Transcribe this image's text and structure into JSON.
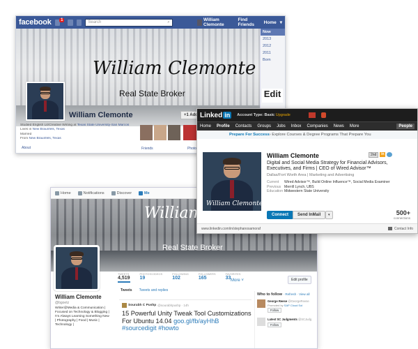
{
  "facebook": {
    "logo": "facebook",
    "notification_count": "1",
    "search_placeholder": "Search",
    "user_name": "William Clemonte",
    "nav": [
      "Find Friends",
      "Home"
    ],
    "cover_script": "William Clemonte",
    "cover_subtitle": "Real State Broker",
    "years": [
      "Now",
      "2013",
      "2012",
      "2011",
      "Born"
    ],
    "edit_text": "Edit",
    "profile_name": "William Clemonte",
    "add_friend": "+1 Add Friend",
    "info": [
      {
        "pre": "Studied English Lit/Creative Writing at ",
        "link": "Texas State University-San Marcos"
      },
      {
        "pre": "Lives in ",
        "link": "New Braunfels, Texas"
      },
      {
        "pre": "Married",
        "link": ""
      },
      {
        "pre": "From ",
        "link": "New Braunfels, Texas"
      }
    ],
    "about": "About",
    "friends": "Friends",
    "photos": "Photos"
  },
  "linkedin": {
    "logo_text": "Linked",
    "logo_in": "in",
    "account": "Account Type: Basic",
    "upgrade": "Upgrade",
    "nav": [
      "Home",
      "Profile",
      "Contacts",
      "Groups",
      "Jobs",
      "Inbox",
      "Companies",
      "News",
      "More"
    ],
    "people": "People",
    "banner_bold": "Prepare For Success",
    "banner_rest": " › Explore Courses & Degree Programs That Prepare You",
    "name": "William Clemonte",
    "degree": "2nd",
    "headline": "Digital and Social Media Strategy for Financial Advisors, Executives, and Firms | CEO of Wired Advisor™",
    "location": "Dallas/Fort Worth Area  |  Marketing and Advertising",
    "rows": [
      {
        "k": "Current",
        "v": "Wired Advisor™, Build Online Influence™, Social Media Examiner"
      },
      {
        "k": "Previous",
        "v": "Merrill Lynch, UBS"
      },
      {
        "k": "Education",
        "v": "Midwestern State University"
      }
    ],
    "connect": "Connect",
    "send_inmail": "Send InMail",
    "connections_num": "500+",
    "connections_lbl": "connections",
    "url": "www.linkedin.com/in/stephanosamoraf",
    "contact_info": "Contact Info",
    "photo_signature": "William Clemonte"
  },
  "twitter": {
    "nav": [
      "Home",
      "Notifications",
      "Discover",
      "Me"
    ],
    "cover_script": "William Cl",
    "cover_subtitle": "Real State Broker",
    "stats": [
      {
        "l": "Tweets",
        "v": "4,519"
      },
      {
        "l": "Photos/Videos",
        "v": "19"
      },
      {
        "l": "Following",
        "v": "102"
      },
      {
        "l": "Followers",
        "v": "165"
      },
      {
        "l": "Favorites",
        "v": "33"
      }
    ],
    "more": "More ˅",
    "edit_profile": "Edit profile",
    "name": "William Clemonte",
    "handle": "@bgoetz",
    "bio": "Writer@Media & Communication | Focused on Technology & Blogging | I'm Always Learning Something New | Photography | Food | Music | Technology |",
    "tabs": [
      "Tweets",
      "Tweets and replies"
    ],
    "tweet_author": "Sourabh C Pushp",
    "tweet_handle": "@sourabhpushp · 14h",
    "tweet_text": "15 Powerful Unity Tweak Tool Customizations For Ubuntu 14.04 ",
    "tweet_link": "goo.gl/fb/ayHhB #sourcedigit #howto",
    "who_to_follow": "Who to follow",
    "wtf_links": "· Refresh · View all",
    "suggestions": [
      {
        "name": "George Reese",
        "handle": "@GeorgeReese",
        "promo_pre": "Promoted by ",
        "promo": "SAP Cloud Sol",
        "follow": "Follow"
      },
      {
        "name": "Latest SC Judgments",
        "handle": "@SCJudg",
        "promo_pre": "",
        "promo": "",
        "follow": "Follow"
      }
    ]
  }
}
